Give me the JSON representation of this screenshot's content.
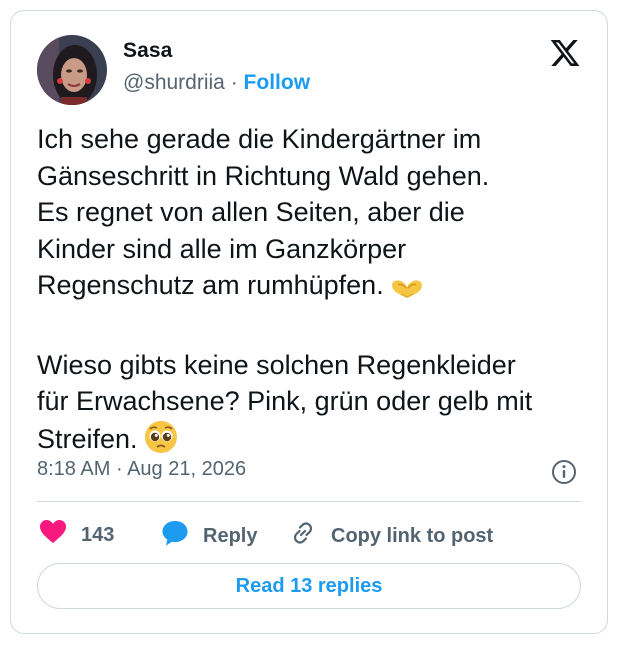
{
  "author": {
    "name": "Sasa",
    "handle": "@shurdriia",
    "separator": "·",
    "follow_label": "Follow"
  },
  "tweet": {
    "lines_p1": [
      "Ich sehe gerade die Kindergärtner im",
      "Gänseschritt in Richtung Wald gehen.",
      "Es regnet von allen Seiten, aber die",
      "Kinder sind alle im Ganzkörper",
      "Regenschutz am rumhüpfen."
    ],
    "lines_p2": [
      "Wieso gibts keine solchen Regenkleider",
      "für Erwachsene? Pink, grün oder gelb mit",
      "Streifen."
    ],
    "emoji_1": "heart-hands-emoji",
    "emoji_2": "pleading-face-emoji"
  },
  "meta": {
    "time": "8:18 AM",
    "separator": "·",
    "date": "Aug 21, 2026"
  },
  "actions": {
    "likes_count": "143",
    "reply_label": "Reply",
    "copy_label": "Copy link to post"
  },
  "read_replies_label": "Read 13 replies",
  "colors": {
    "accent": "#1d9bf0",
    "like": "#f91880",
    "text": "#0f1419",
    "muted": "#536471",
    "border": "#cfd9de"
  },
  "icons": [
    "x-logo-icon",
    "info-icon",
    "heart-icon",
    "reply-bubble-icon",
    "link-icon"
  ]
}
